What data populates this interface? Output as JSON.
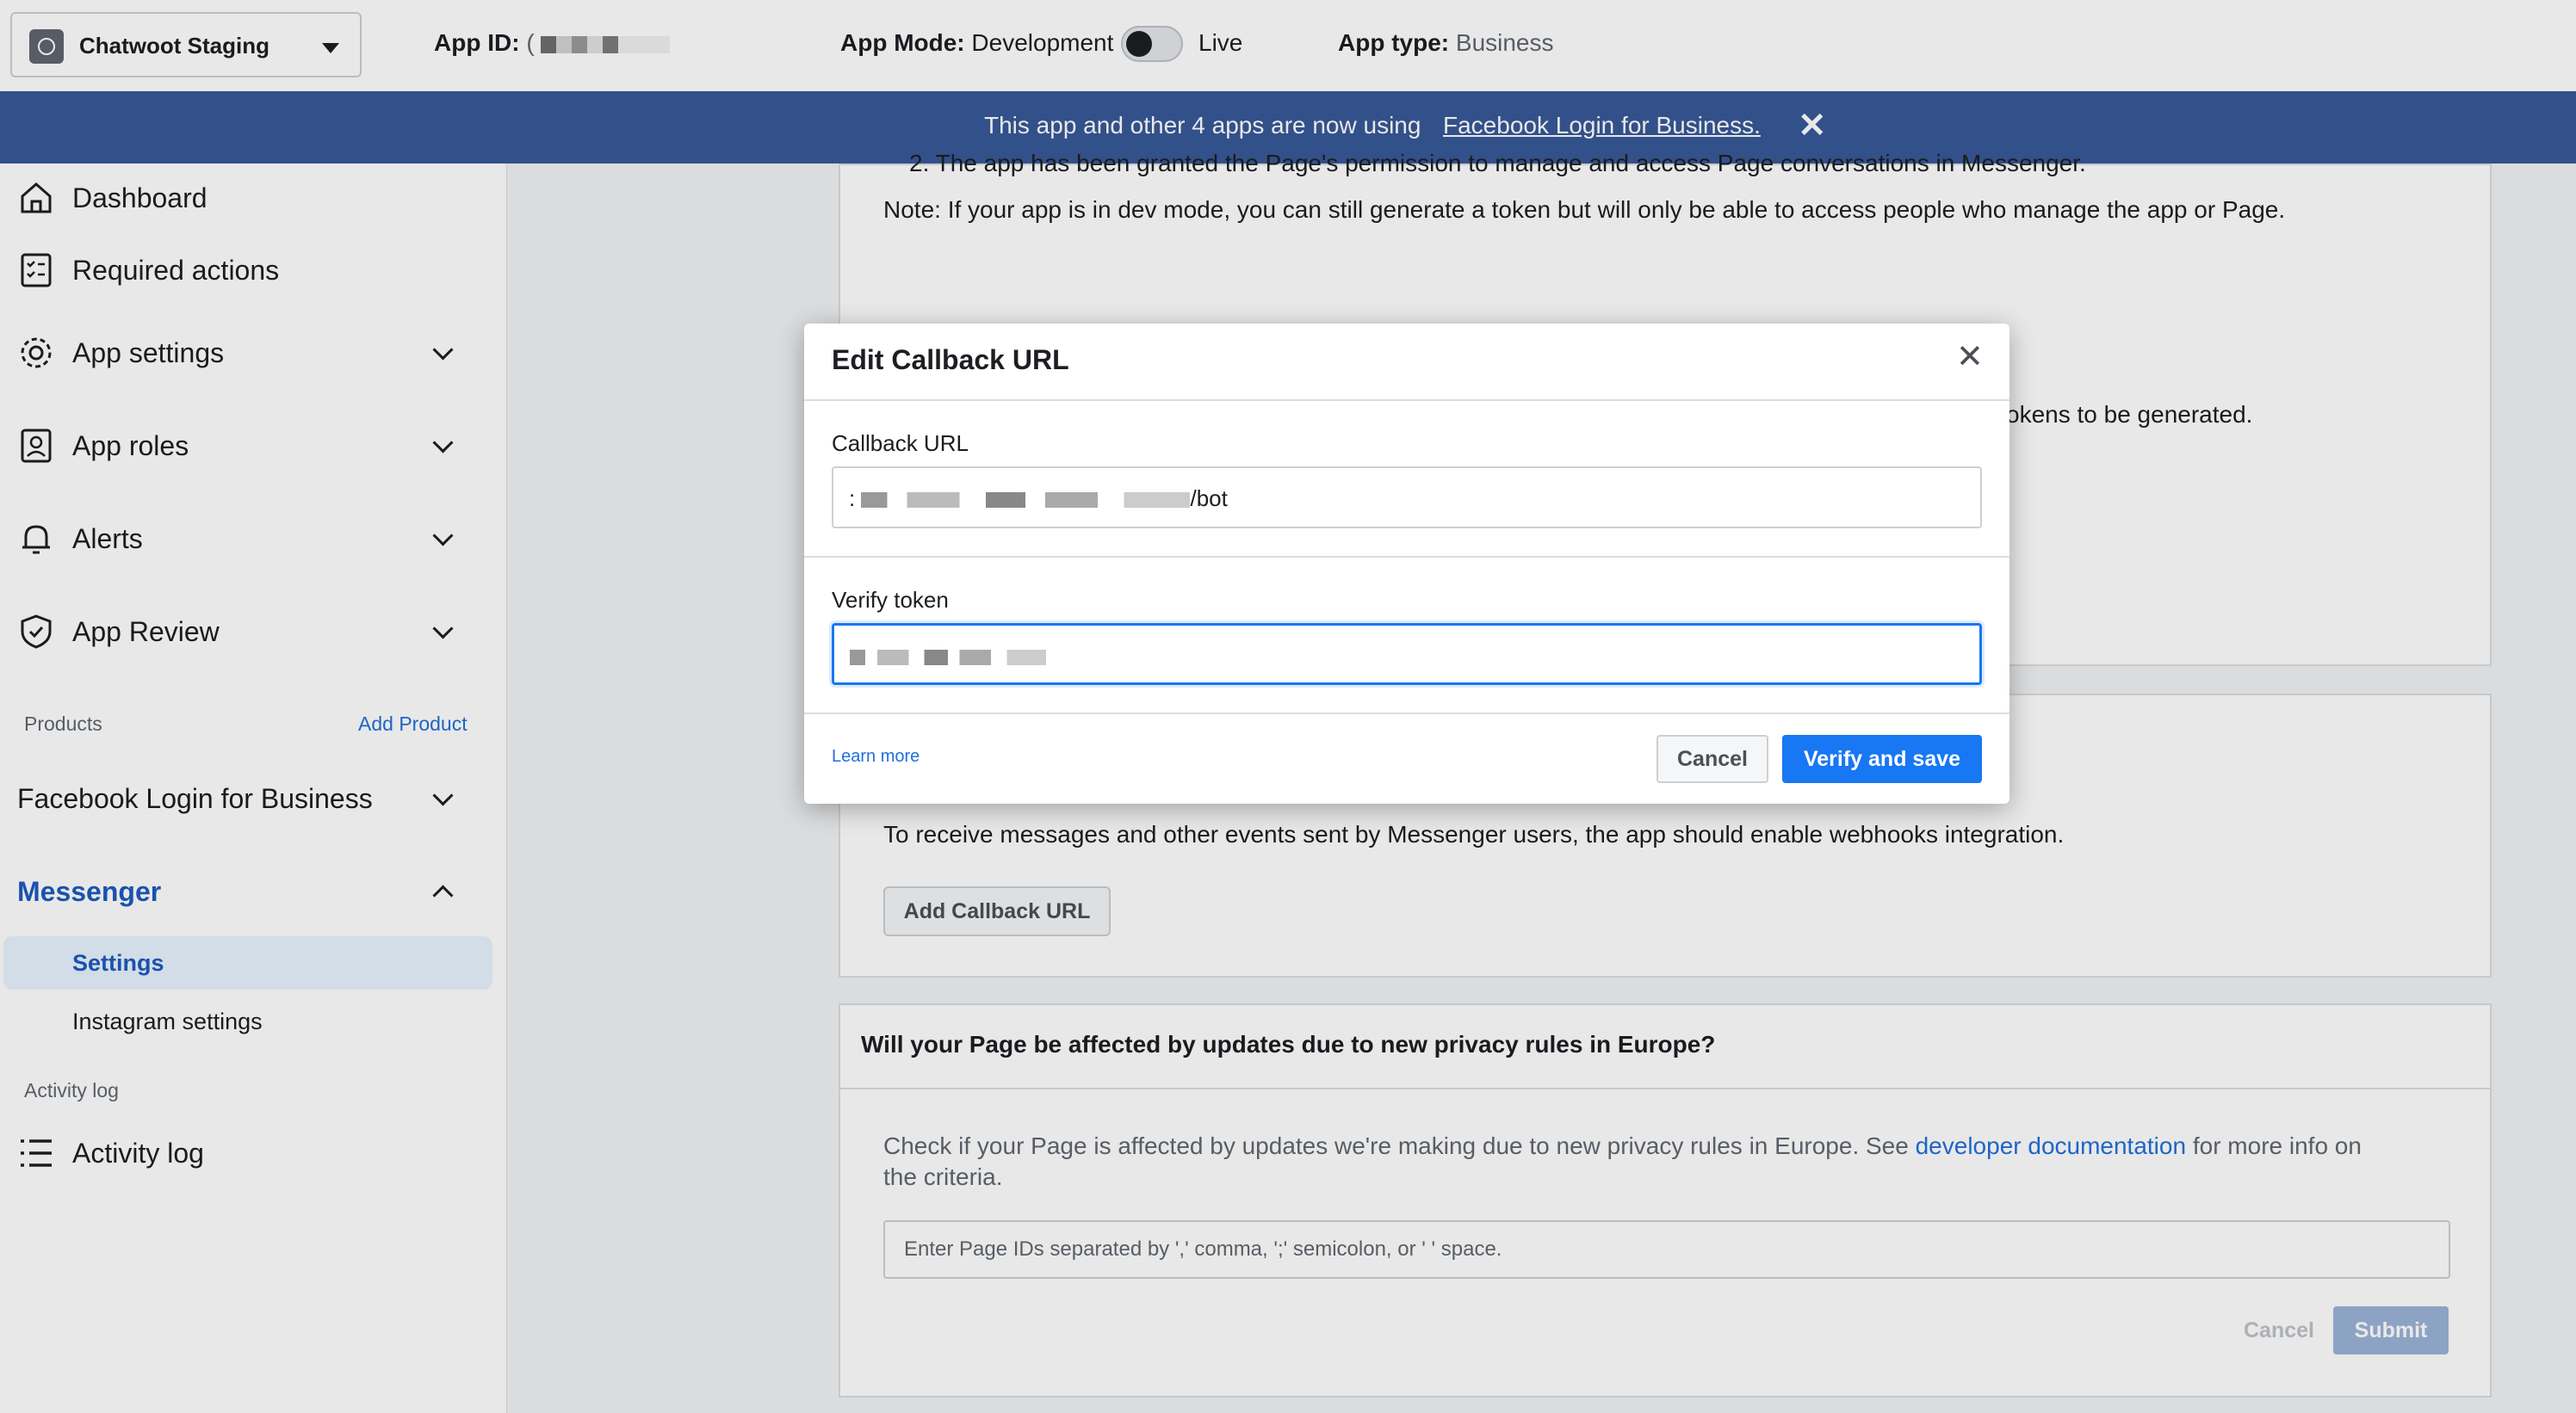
{
  "topbar": {
    "app_name": "Chatwoot Staging",
    "app_id_label": "App ID:",
    "app_id_value": "(",
    "app_mode_label": "App Mode:",
    "app_mode_value": "Development",
    "live_label": "Live",
    "app_type_label": "App type:",
    "app_type_value": "Business"
  },
  "banner": {
    "text": "This app and other 4 apps are now using",
    "link": "Facebook Login for Business.",
    "close": "✕"
  },
  "sidebar": {
    "dashboard": "Dashboard",
    "required_actions": "Required actions",
    "app_settings": "App settings",
    "app_roles": "App roles",
    "alerts": "Alerts",
    "app_review": "App Review",
    "products_label": "Products",
    "add_product": "Add Product",
    "facebook_login": "Facebook Login for Business",
    "messenger": "Messenger",
    "settings": "Settings",
    "instagram_settings": "Instagram settings",
    "activity_log_label": "Activity log",
    "activity_log": "Activity log"
  },
  "main": {
    "granted_text": "2. The app has been granted the Page's permission to manage and access Page conversations in Messenger.",
    "note_text": "Note: If your app is in dev mode, you can still generate a token but will only be able to access people who manage the app or Page.",
    "tokens_text": "okens to be generated.",
    "webhooks_text": "To receive messages and other events sent by Messenger users, the app should enable webhooks integration.",
    "add_callback_button": "Add Callback URL",
    "privacy_title": "Will your Page be affected by updates due to new privacy rules in Europe?",
    "privacy_text_before": "Check if your Page is affected by updates we're making due to new privacy rules in Europe. See",
    "privacy_link": "developer documentation",
    "privacy_text_after": "for more info on",
    "privacy_text_line2": "the criteria.",
    "page_ids_placeholder": "Enter Page IDs separated by ',' comma, ';' semicolon, or ' ' space.",
    "cancel": "Cancel",
    "submit": "Submit"
  },
  "modal": {
    "title": "Edit Callback URL",
    "close": "✕",
    "callback_label": "Callback URL",
    "callback_prefix": ":",
    "callback_suffix": "/bot",
    "verify_label": "Verify token",
    "learn_more": "Learn more",
    "cancel": "Cancel",
    "verify_save": "Verify and save"
  },
  "colors": {
    "banner": "#385898",
    "primary": "#1877f2",
    "link": "#216fdb",
    "active_nav": "#1d5bbf"
  }
}
